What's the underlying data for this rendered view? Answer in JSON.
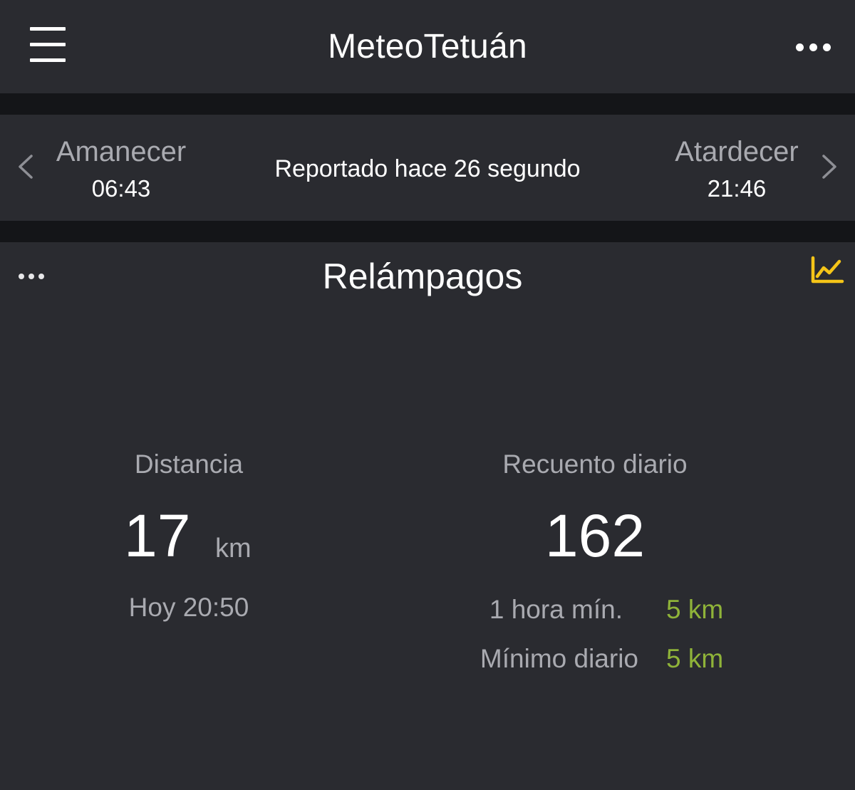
{
  "app": {
    "title": "MeteoTetuán"
  },
  "icons": {
    "menu": "hamburger-menu-icon",
    "more": "more-dots-icon",
    "prev": "chevron-left-icon",
    "next": "chevron-right-icon",
    "chart": "line-chart-icon"
  },
  "colors": {
    "background": "#2a2b30",
    "accent": "#f5c518",
    "positive": "#8fb339"
  },
  "sun": {
    "sunrise_label": "Amanecer",
    "sunrise_time": "06:43",
    "sunset_label": "Atardecer",
    "sunset_time": "21:46",
    "reported": "Reportado hace 26 segundo"
  },
  "lightning": {
    "title": "Relámpagos",
    "distance": {
      "label": "Distancia",
      "value": "17",
      "unit": "km",
      "time": "Hoy 20:50"
    },
    "daily_count": {
      "label": "Recuento diario",
      "value": "162",
      "hour_min_label": "1 hora mín.",
      "hour_min_value": "5 km",
      "daily_min_label": "Mínimo diario",
      "daily_min_value": "5 km"
    }
  }
}
